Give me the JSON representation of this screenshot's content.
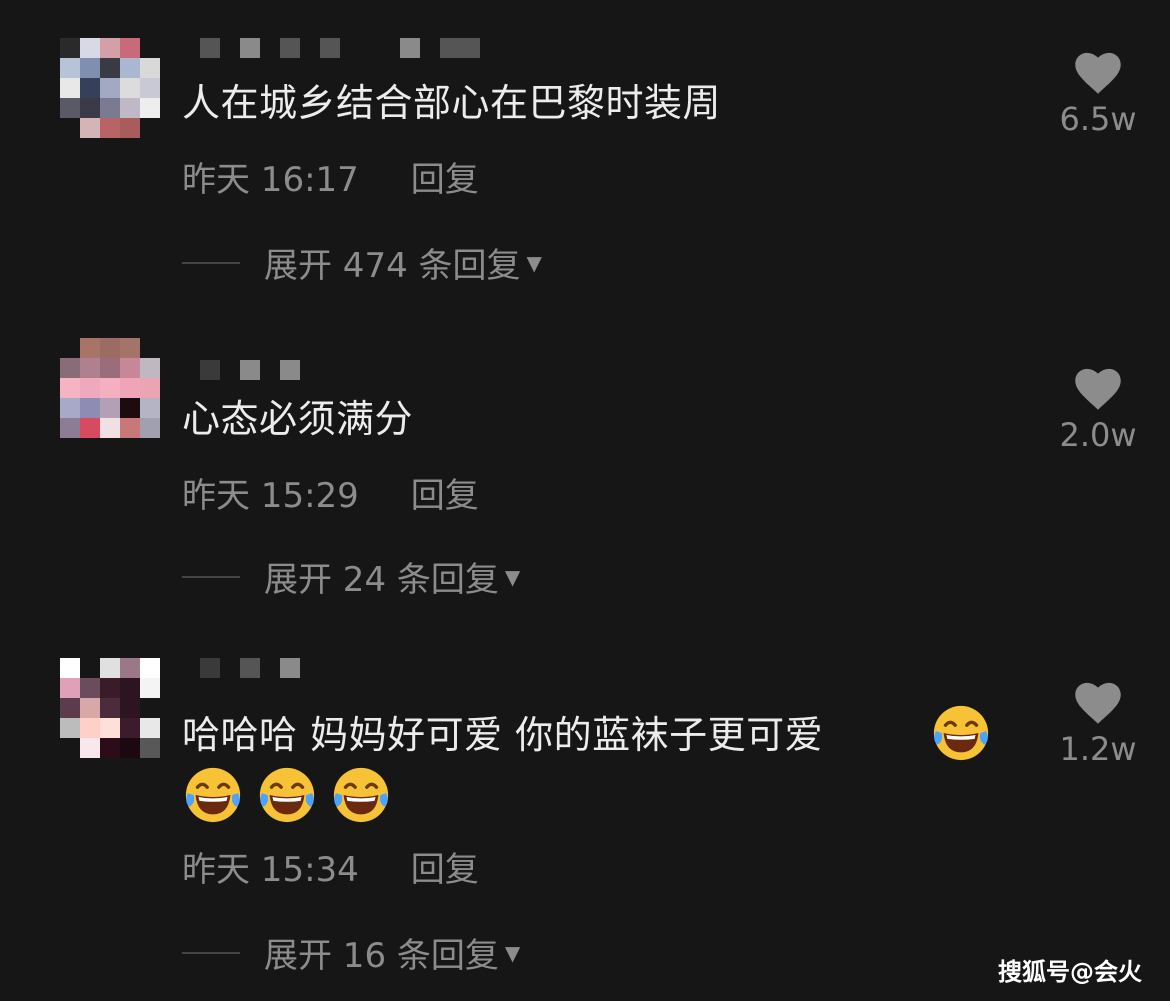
{
  "comments": [
    {
      "text": "人在城乡结合部心在巴黎时装周",
      "time": "昨天 16:17",
      "reply_label": "回复",
      "expand_label": "展开 474 条回复",
      "likes": "6.5w"
    },
    {
      "text": "心态必须满分",
      "time": "昨天 15:29",
      "reply_label": "回复",
      "expand_label": "展开 24 条回复",
      "likes": "2.0w"
    },
    {
      "text": "哈哈哈 妈妈好可爱 你的蓝袜子更可爱",
      "time": "昨天 15:34",
      "reply_label": "回复",
      "expand_label": "展开 16 条回复",
      "likes": "1.2w",
      "emoji": "face-with-tears-of-joy"
    }
  ],
  "watermark": "搜狐号@会火",
  "icons": {
    "like": "heart-icon",
    "expand": "caret-down-icon",
    "emoji": "face-with-tears-of-joy-emoji"
  },
  "colors": {
    "background": "#161616",
    "text": "#ececec",
    "secondary": "#8c8c8c",
    "emoji_face": "#f7c236"
  }
}
